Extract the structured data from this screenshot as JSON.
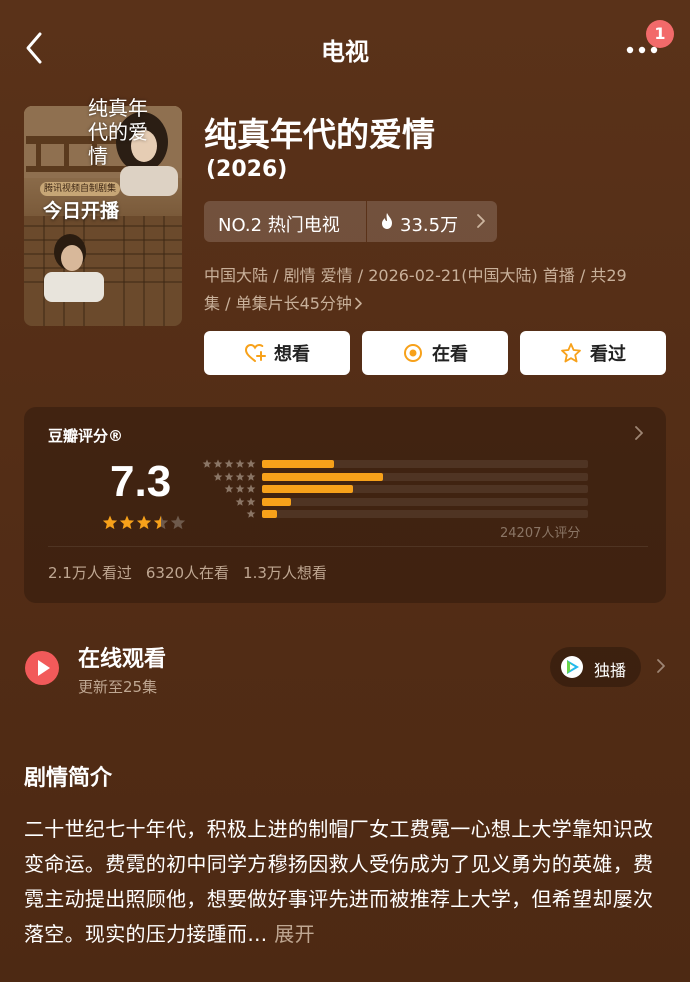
{
  "header": {
    "title": "电视",
    "notification_count": "1"
  },
  "poster": {
    "title": "纯真年代的爱情",
    "tag": "腾讯视频自制剧集",
    "banner": "今日开播"
  },
  "show": {
    "title": "纯真年代的爱情",
    "year": "(2026)",
    "rank": "NO.2 热门电视",
    "heat": "33.5万",
    "meta_line1": "中国大陆 / 剧情 爱情 / 2026-02-21(中国大陆) 首播 / 共29",
    "meta_line2": "集 / 单集片长45分钟"
  },
  "actions": [
    {
      "label": "想看",
      "icon": "heart-plus-icon"
    },
    {
      "label": "在看",
      "icon": "target-icon"
    },
    {
      "label": "看过",
      "icon": "star-outline-icon"
    }
  ],
  "rating": {
    "title": "豆瓣评分®",
    "score": "7.3",
    "stars_value": 3.5,
    "distribution": [
      {
        "stars": 5,
        "fraction": 0.22
      },
      {
        "stars": 4,
        "fraction": 0.37
      },
      {
        "stars": 3,
        "fraction": 0.28
      },
      {
        "stars": 2,
        "fraction": 0.09
      },
      {
        "stars": 1,
        "fraction": 0.045
      }
    ],
    "count": "24207人评分",
    "watched": "2.1万人看过",
    "watching": "6320人在看",
    "want": "1.3万人想看"
  },
  "watch": {
    "title": "在线观看",
    "subtitle": "更新至25集",
    "platform_label": "独播"
  },
  "synopsis": {
    "heading": "剧情简介",
    "text": "二十世纪七十年代，积极上进的制帽厂女工费霓一心想上大学靠知识改变命运。费霓的初中同学方穆扬因救人受伤成为了见义勇为的英雄，费霓主动提出照顾他，想要做好事评先进而被推荐上大学，但希望却屡次落空。现实的压力接踵而…",
    "expand": "展开"
  },
  "colors": {
    "background": "#5a3219",
    "accent_orange": "#f7a11a",
    "badge_red": "#f26a6a"
  }
}
